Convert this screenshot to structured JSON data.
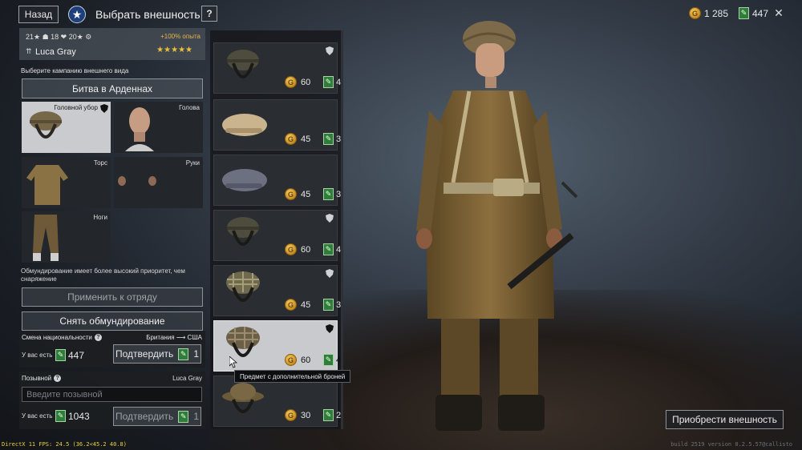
{
  "header": {
    "back_label": "Назад",
    "title": "Выбрать внешность",
    "help_label": "?",
    "gold_amount": "1 285",
    "tickets_amount": "447",
    "close_label": "✕"
  },
  "soldier": {
    "stats": "21★ ☗ 18 ❤ 20★ ⚙",
    "xp_bonus": "+100% опыта",
    "name": "Luca Gray",
    "stars": "★★★★★",
    "rank_icon": "⇈"
  },
  "campaign": {
    "label": "Выберите кампанию внешнего вида",
    "selected": "Битва в Арденнах"
  },
  "slots": {
    "headgear": "Головной убор",
    "head": "Голова",
    "torso": "Торс",
    "hands": "Руки",
    "legs": "Ноги"
  },
  "priority_note": "Обмундирование имеет более высокий приоритет, чем снаряжение",
  "actions": {
    "apply_to_squad": "Применить к отряду",
    "remove_outfit": "Снять обмундирование",
    "purchase": "Приобрести внешность"
  },
  "nationality": {
    "title": "Смена национальности",
    "help": "?",
    "route": "Британия ⟶ США",
    "have_label": "У вас есть",
    "have_value": "447",
    "confirm_label": "Подтвердить",
    "cost": "1"
  },
  "callsign": {
    "title": "Позывной",
    "help": "?",
    "current": "Luca Gray",
    "placeholder": "Введите позывной",
    "have_label": "У вас есть",
    "have_value": "1043",
    "confirm_label": "Подтвердить",
    "cost": "1"
  },
  "items": [
    {
      "kind": "helmet",
      "gold": "60",
      "tickets": "4",
      "armored": true,
      "selected": false
    },
    {
      "kind": "beret-tan",
      "gold": "45",
      "tickets": "3",
      "armored": false,
      "selected": false
    },
    {
      "kind": "beret-grey",
      "gold": "45",
      "tickets": "3",
      "armored": false,
      "selected": false
    },
    {
      "kind": "helmet",
      "gold": "60",
      "tickets": "4",
      "armored": true,
      "selected": false
    },
    {
      "kind": "helmet-net",
      "gold": "45",
      "tickets": "3",
      "armored": true,
      "selected": false
    },
    {
      "kind": "helmet-camo",
      "gold": "60",
      "tickets": "4",
      "armored": true,
      "selected": true
    },
    {
      "kind": "helmet-brodie",
      "gold": "30",
      "tickets": "2",
      "armored": false,
      "selected": false
    }
  ],
  "tooltip": "Предмет с дополнительной броней",
  "debug": {
    "left": "DirectX 11 FPS: 24.5 (36.2<45.2 40.8)",
    "right": "build 2519 version 0.2.5.57@callisto"
  },
  "icons": {
    "gold": "gold-coin-icon",
    "tickets": "ticket-icon",
    "shield": "armor-shield-icon"
  },
  "colors": {
    "gold": "#e5b74b",
    "ticket_green": "#2f7d3a",
    "selected_bg": "#c8cacd"
  }
}
